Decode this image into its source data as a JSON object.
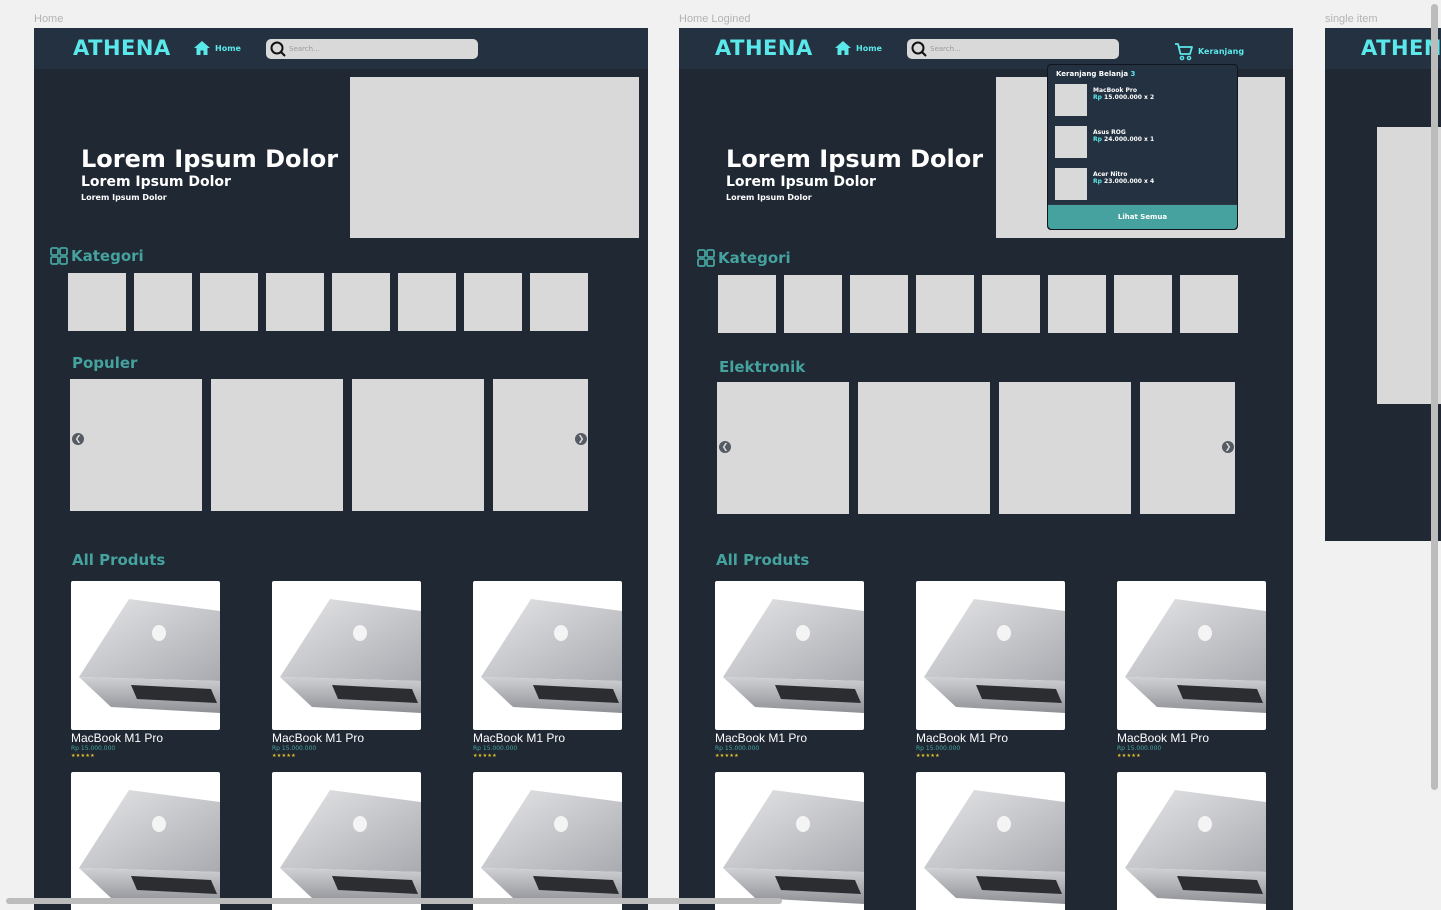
{
  "frames": {
    "home": {
      "label": "Home"
    },
    "home_logined": {
      "label": "Home Logined"
    },
    "single_item": {
      "label": "single item"
    }
  },
  "brand": {
    "logo": "ATHENA",
    "accent": "#5ae8ea",
    "teal": "#45a29e",
    "bg": "#1f2833"
  },
  "nav": {
    "home_label": "Home",
    "search_placeholder": "Search...",
    "cart_label": "Keranjang"
  },
  "hero": {
    "title": "Lorem Ipsum Dolor",
    "subtitle": "Lorem Ipsum Dolor",
    "caption": "Lorem Ipsum Dolor"
  },
  "sections": {
    "kategori": "Kategori",
    "populer": "Populer",
    "elektronik": "Elektronik",
    "all_products": "All Produts"
  },
  "cart": {
    "title": "Keranjang Belanja",
    "count": "3",
    "items": [
      {
        "name": "MacBook Pro",
        "currency": "Rp",
        "price": "15.000.000 x 2"
      },
      {
        "name": "Asus ROG",
        "currency": "Rp",
        "price": "24.000.000 x 1"
      },
      {
        "name": "Acer Nitro",
        "currency": "Rp",
        "price": "23.000.000 x 4"
      }
    ],
    "view_all": "Lihat Semua"
  },
  "products": [
    {
      "name": "MacBook M1 Pro",
      "price": "Rp 15.000.000",
      "stars": "★★★★★"
    },
    {
      "name": "MacBook M1 Pro",
      "price": "Rp 15.000.000",
      "stars": "★★★★★"
    },
    {
      "name": "MacBook M1 Pro",
      "price": "Rp 15.000.000",
      "stars": "★★★★★"
    },
    {
      "name": "",
      "price": "",
      "stars": ""
    },
    {
      "name": "",
      "price": "",
      "stars": ""
    },
    {
      "name": "",
      "price": "",
      "stars": ""
    }
  ],
  "icons": {
    "home": "home-icon",
    "search": "search-icon",
    "cart": "cart-icon",
    "grid": "grid-icon",
    "prev": "chevron-left-icon",
    "next": "chevron-right-icon"
  }
}
